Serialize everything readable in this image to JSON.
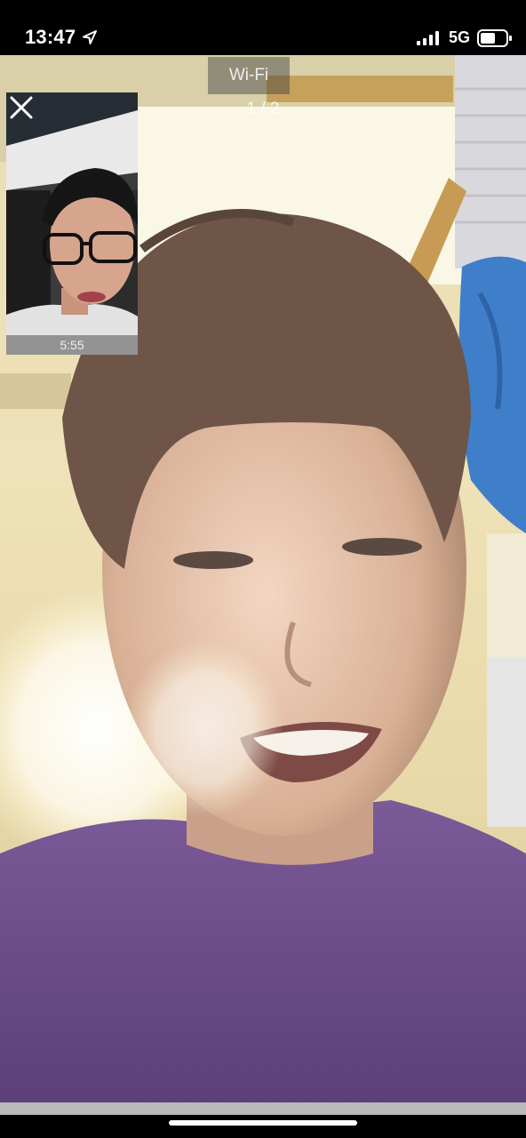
{
  "status_bar": {
    "time": "13:47",
    "network": "5G",
    "icons": [
      "location-arrow-icon",
      "signal-bars-icon",
      "battery-icon"
    ]
  },
  "call": {
    "wifi_label": "Wi-Fi",
    "page_indicator": "1 / 2",
    "self_view": {
      "timer": "5:55",
      "close_icon": "close-icon"
    }
  },
  "colors": {
    "shirt_purple": "#6b4a86",
    "background_wall": "#ecdcae",
    "status_bar_bg": "#000000"
  }
}
